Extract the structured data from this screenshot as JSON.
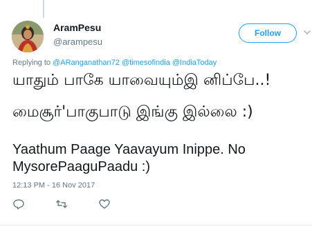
{
  "tweet": {
    "display_name": "AramPesu",
    "handle": "@arampesu",
    "follow_label": "Follow",
    "reply_prefix": "Replying to",
    "reply_mentions": "@ARanganathan72 @timesofindia @IndiaToday",
    "line1": "யாதும் பாகே யாவையும்இ னிப்பே..!",
    "line2": "மைசூர்'பாகுபாடு இங்கு இல்லை :)",
    "line3": "Yaathum Paage Yaavayum Inippe. No MysorePaaguPaadu :)",
    "timestamp": "12:13 PM - 16 Nov 2017"
  },
  "icons": {
    "reply": "reply-icon",
    "retweet": "retweet-icon",
    "like": "like-icon",
    "caret": "chevron-down-icon"
  },
  "colors": {
    "accent": "#1da1f2",
    "secondary_text": "#657786",
    "primary_text": "#14171a"
  }
}
